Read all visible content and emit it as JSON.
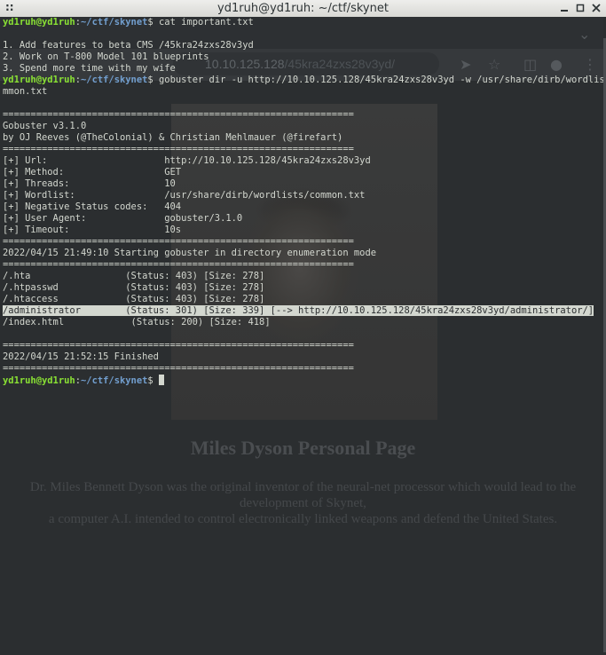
{
  "window": {
    "title": "yd1ruh@yd1ruh: ~/ctf/skynet",
    "menu_glyph": "::"
  },
  "background_page": {
    "address_host": "10.10.125.128",
    "address_path": "/45kra24zxs28v3yd/",
    "heading": "Miles Dyson Personal Page",
    "paragraph_line1": "Dr. Miles Bennett Dyson was the original inventor of the neural-net processor which would lead to the development of Skynet,",
    "paragraph_line2": "a computer A.I. intended to control electronically linked weapons and defend the United States."
  },
  "terminal": {
    "prompt_user": "yd1ruh@yd1ruh",
    "prompt_sep": ":",
    "prompt_path": "~/ctf/skynet",
    "prompt_sigil": "$",
    "cmd1": " cat important.txt",
    "file_lines": [
      "",
      "1. Add features to beta CMS /45kra24zxs28v3yd",
      "2. Work on T-800 Model 101 blueprints",
      "3. Spend more time with my wife"
    ],
    "cmd2": " gobuster dir -u http://10.10.125.128/45kra24zxs28v3yd -w /usr/share/dirb/wordlists/co",
    "cmd2_wrap": "mmon.txt",
    "separator": "===============================================================",
    "banner": [
      "Gobuster v3.1.0",
      "by OJ Reeves (@TheColonial) & Christian Mehlmauer (@firefart)"
    ],
    "config": [
      "[+] Url:                     http://10.10.125.128/45kra24zxs28v3yd",
      "[+] Method:                  GET",
      "[+] Threads:                 10",
      "[+] Wordlist:                /usr/share/dirb/wordlists/common.txt",
      "[+] Negative Status codes:   404",
      "[+] User Agent:              gobuster/3.1.0",
      "[+] Timeout:                 10s"
    ],
    "start_line": "2022/04/15 21:49:10 Starting gobuster in directory enumeration mode",
    "results": [
      "/.hta                 (Status: 403) [Size: 278]",
      "/.htpasswd            (Status: 403) [Size: 278]",
      "/.htaccess            (Status: 403) [Size: 278]"
    ],
    "result_highlighted": "/administrator        (Status: 301) [Size: 339] [--> http://10.10.125.128/45kra24zxs28v3yd/administrator/]",
    "result_last": "/index.html            (Status: 200) [Size: 418]",
    "finish_line": "2022/04/15 21:52:15 Finished"
  },
  "colors": {
    "terminal_bg": "#2b2e30",
    "text": "#d3d7cf",
    "prompt_user": "#8ae234",
    "prompt_path": "#729fcf",
    "titlebar": "#e6e6e2"
  }
}
